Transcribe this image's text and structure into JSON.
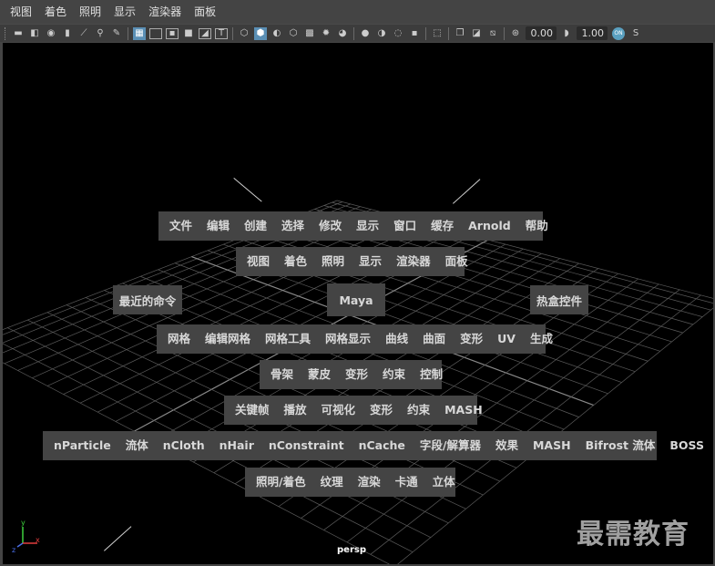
{
  "menubar": {
    "items": [
      "视图",
      "着色",
      "照明",
      "显示",
      "渲染器",
      "面板"
    ]
  },
  "toolbar": {
    "value_a": "0.00",
    "value_b": "1.00",
    "toggle_label": "ON",
    "trailing": "S"
  },
  "hotbox": {
    "row1": [
      "文件",
      "编辑",
      "创建",
      "选择",
      "修改",
      "显示",
      "窗口",
      "缓存",
      "Arnold",
      "帮助"
    ],
    "row2": [
      "视图",
      "着色",
      "照明",
      "显示",
      "渲染器",
      "面板"
    ],
    "recent": "最近的命令",
    "center": "Maya",
    "hotbox_controls": "热盒控件",
    "row4": [
      "网格",
      "编辑网格",
      "网格工具",
      "网格显示",
      "曲线",
      "曲面",
      "变形",
      "UV",
      "生成"
    ],
    "row5": [
      "骨架",
      "蒙皮",
      "变形",
      "约束",
      "控制"
    ],
    "row6": [
      "关键帧",
      "播放",
      "可视化",
      "变形",
      "约束",
      "MASH"
    ],
    "row7": [
      "nParticle",
      "流体",
      "nCloth",
      "nHair",
      "nConstraint",
      "nCache",
      "字段/解算器",
      "效果",
      "MASH",
      "Bifrost 流体",
      "BOSS"
    ],
    "row8": [
      "照明/着色",
      "纹理",
      "渲染",
      "卡通",
      "立体"
    ]
  },
  "viewport": {
    "camera": "persp",
    "axis": {
      "x": "x",
      "y": "y",
      "z": "z"
    }
  },
  "watermark": "最需教育",
  "colors": {
    "panel_bg": "#444444",
    "viewport_bg": "#000000",
    "active_icon": "#5a8fb5",
    "grid": "#5a5a5a"
  }
}
